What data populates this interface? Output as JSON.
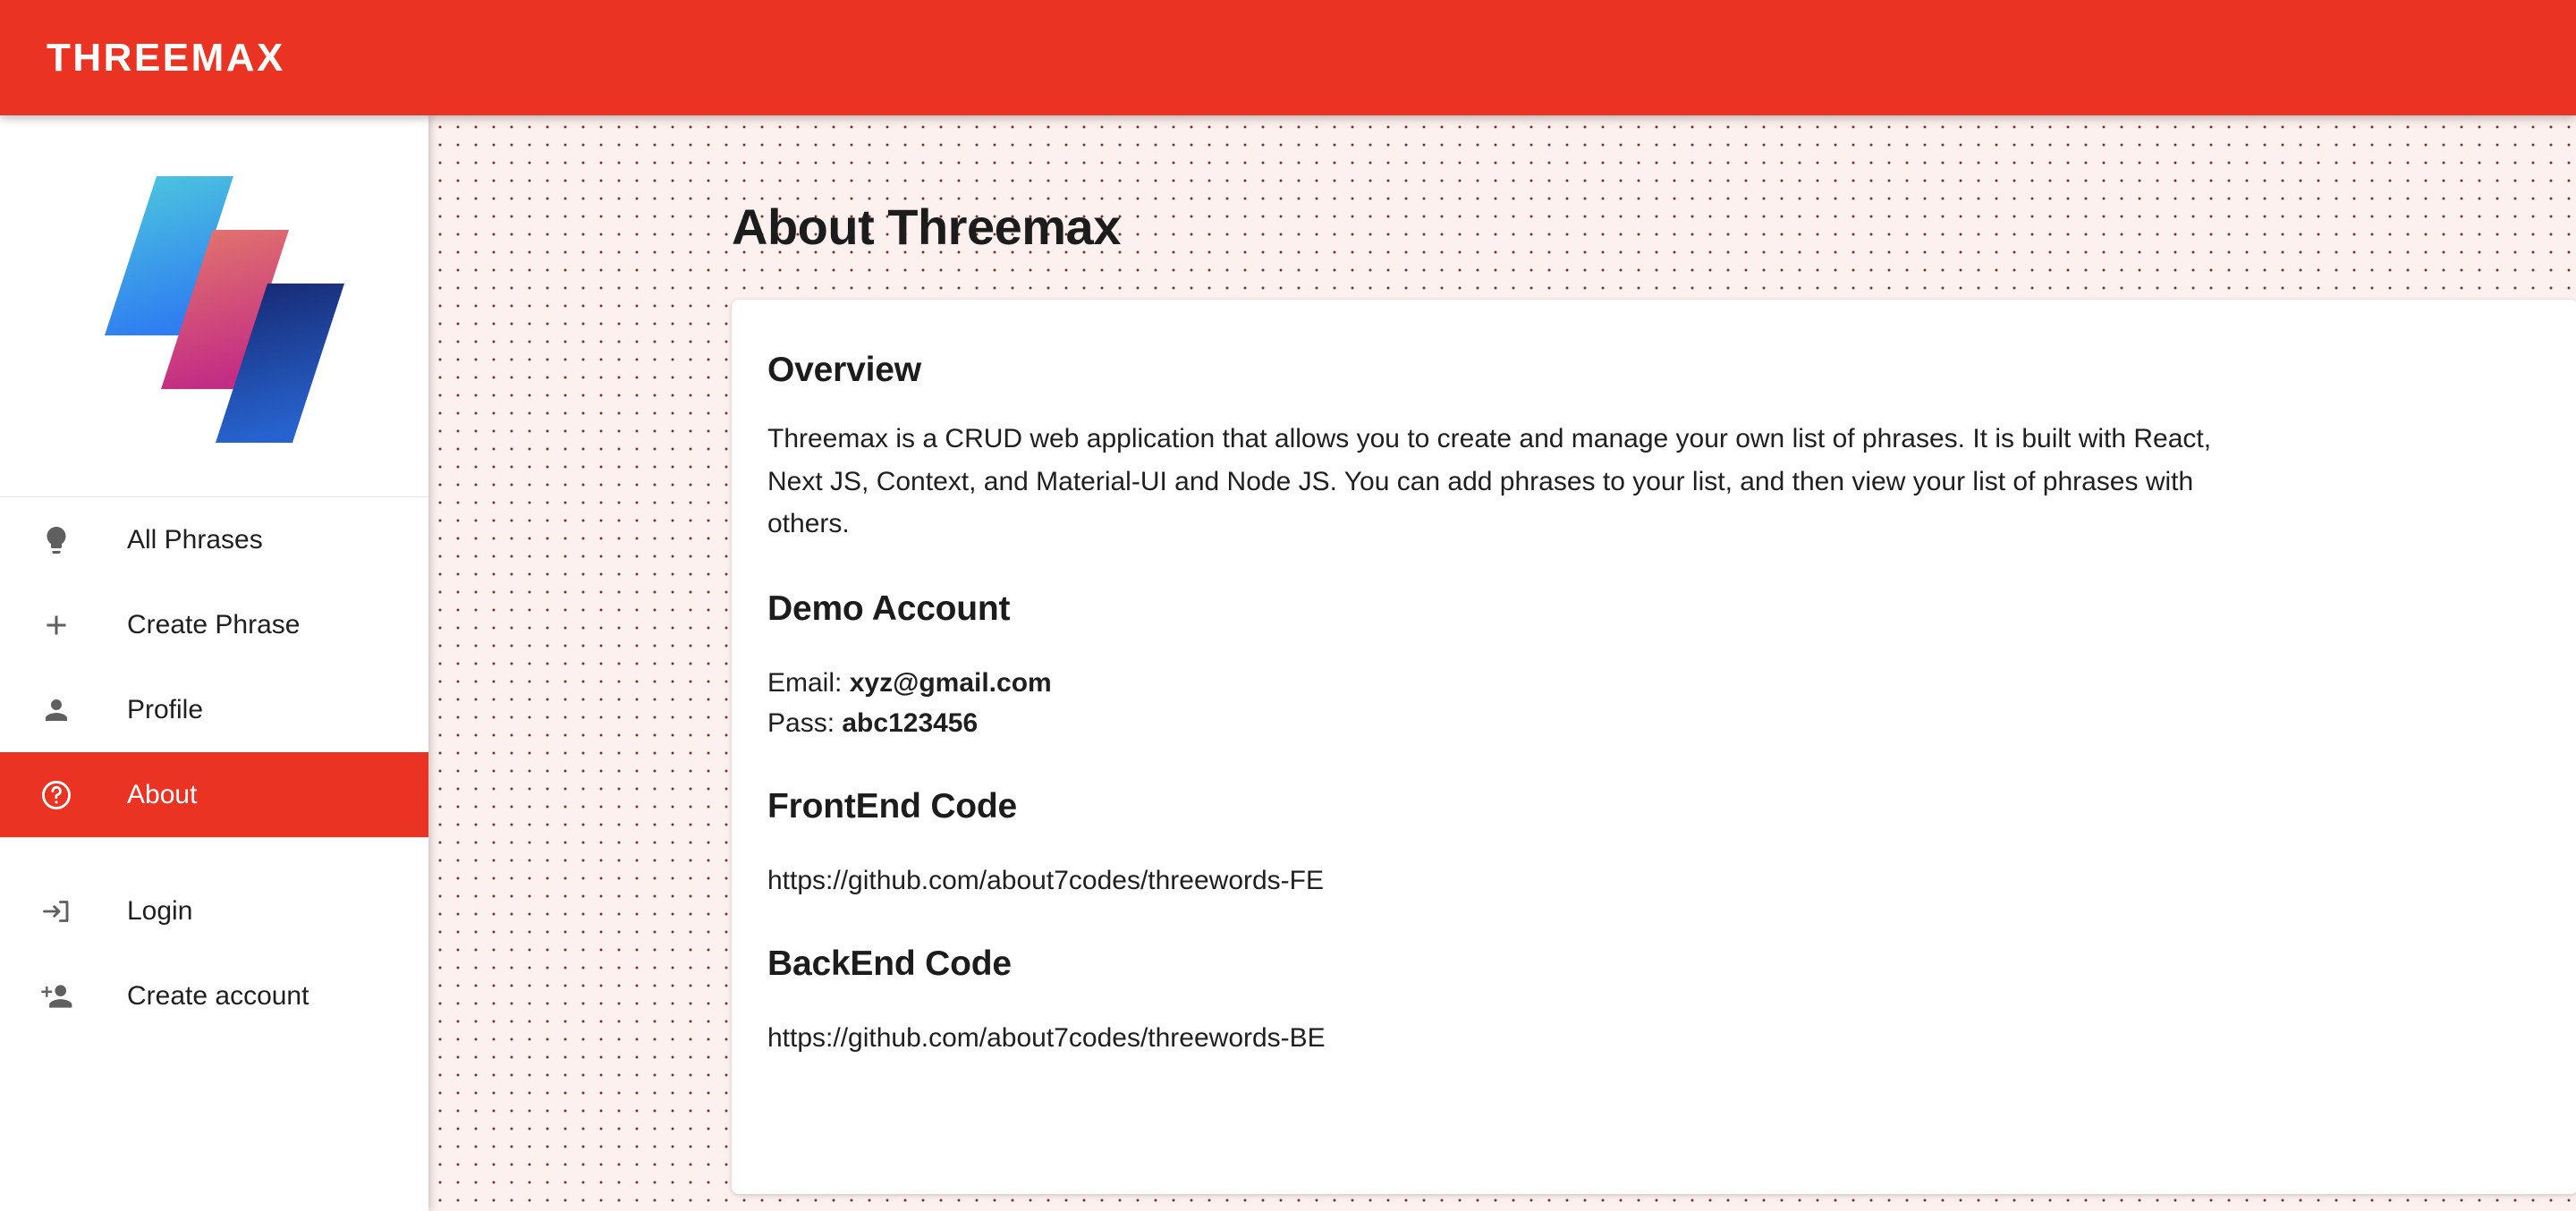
{
  "appbar": {
    "brand": "THREEMAX",
    "color": "#ea3323"
  },
  "sidebar": {
    "logo_name": "threemax-logo",
    "logo_colors": {
      "shape1_from": "#4ecadd",
      "shape1_to": "#2f7ff0",
      "shape2_from": "#e2776c",
      "shape2_to": "#c42d84",
      "shape3_from": "#16276e",
      "shape3_to": "#2763cf"
    },
    "items": [
      {
        "label": "All Phrases",
        "icon": "lightbulb-icon",
        "active": false
      },
      {
        "label": "Create Phrase",
        "icon": "plus-icon",
        "active": false
      },
      {
        "label": "Profile",
        "icon": "person-icon",
        "active": false
      },
      {
        "label": "About",
        "icon": "help-circle-icon",
        "active": true
      },
      {
        "label": "Login",
        "icon": "login-arrow-icon",
        "active": false
      },
      {
        "label": "Create account",
        "icon": "person-add-icon",
        "active": false
      }
    ]
  },
  "main": {
    "page_title": "About Threemax",
    "background_color": "#fcf1ef",
    "dot_color": "#7d2b1e",
    "sections": {
      "overview": {
        "heading": "Overview",
        "paragraph": "Threemax is a CRUD web application that allows you to create and manage your own list of phrases. It is built with React, Next JS, Context, and Material-UI and Node JS. You can add phrases to your list, and then view your list of phrases with others."
      },
      "demo_account": {
        "heading": "Demo Account",
        "email_label": "Email:",
        "email_value": "xyz@gmail.com",
        "pass_label": "Pass:",
        "pass_value": "abc123456"
      },
      "frontend": {
        "heading": "FrontEnd Code",
        "url": "https://github.com/about7codes/threewords-FE"
      },
      "backend": {
        "heading": "BackEnd Code",
        "url": "https://github.com/about7codes/threewords-BE"
      }
    }
  }
}
